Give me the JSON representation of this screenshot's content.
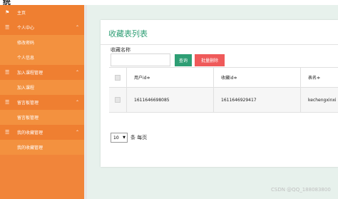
{
  "app": {
    "title_fragment": "统"
  },
  "sidebar": {
    "items": [
      {
        "label": "主页",
        "icon": "flag-icon"
      },
      {
        "label": "个人中心",
        "icon": "menu-icon",
        "expanded": true
      },
      {
        "label": "修改密码"
      },
      {
        "label": "个人信息"
      },
      {
        "label": "加入课程管理",
        "icon": "menu-icon",
        "expanded": true
      },
      {
        "label": "加入课程"
      },
      {
        "label": "留言板管理",
        "icon": "menu-icon",
        "expanded": true
      },
      {
        "label": "留言板管理"
      },
      {
        "label": "我的收藏管理",
        "icon": "menu-icon",
        "expanded": true
      },
      {
        "label": "我的收藏管理"
      }
    ]
  },
  "page": {
    "title": "收藏表列表",
    "search": {
      "label": "收藏名称",
      "value": "",
      "placeholder": ""
    },
    "buttons": {
      "query": "查询",
      "batch_delete": "批量删除"
    }
  },
  "table": {
    "headers": [
      "用户id≑",
      "收藏id≑",
      "表名≑"
    ],
    "rows": [
      [
        "1611646698085",
        "1611646929417",
        "kechengxinxi"
      ]
    ]
  },
  "pagination": {
    "page_size": "10",
    "suffix": "条 每页"
  },
  "watermark": "CSDN @QQ_188083800",
  "colors": {
    "sidebar": "#f1853a",
    "accent": "#2e9e74",
    "danger": "#ef5a5a"
  }
}
